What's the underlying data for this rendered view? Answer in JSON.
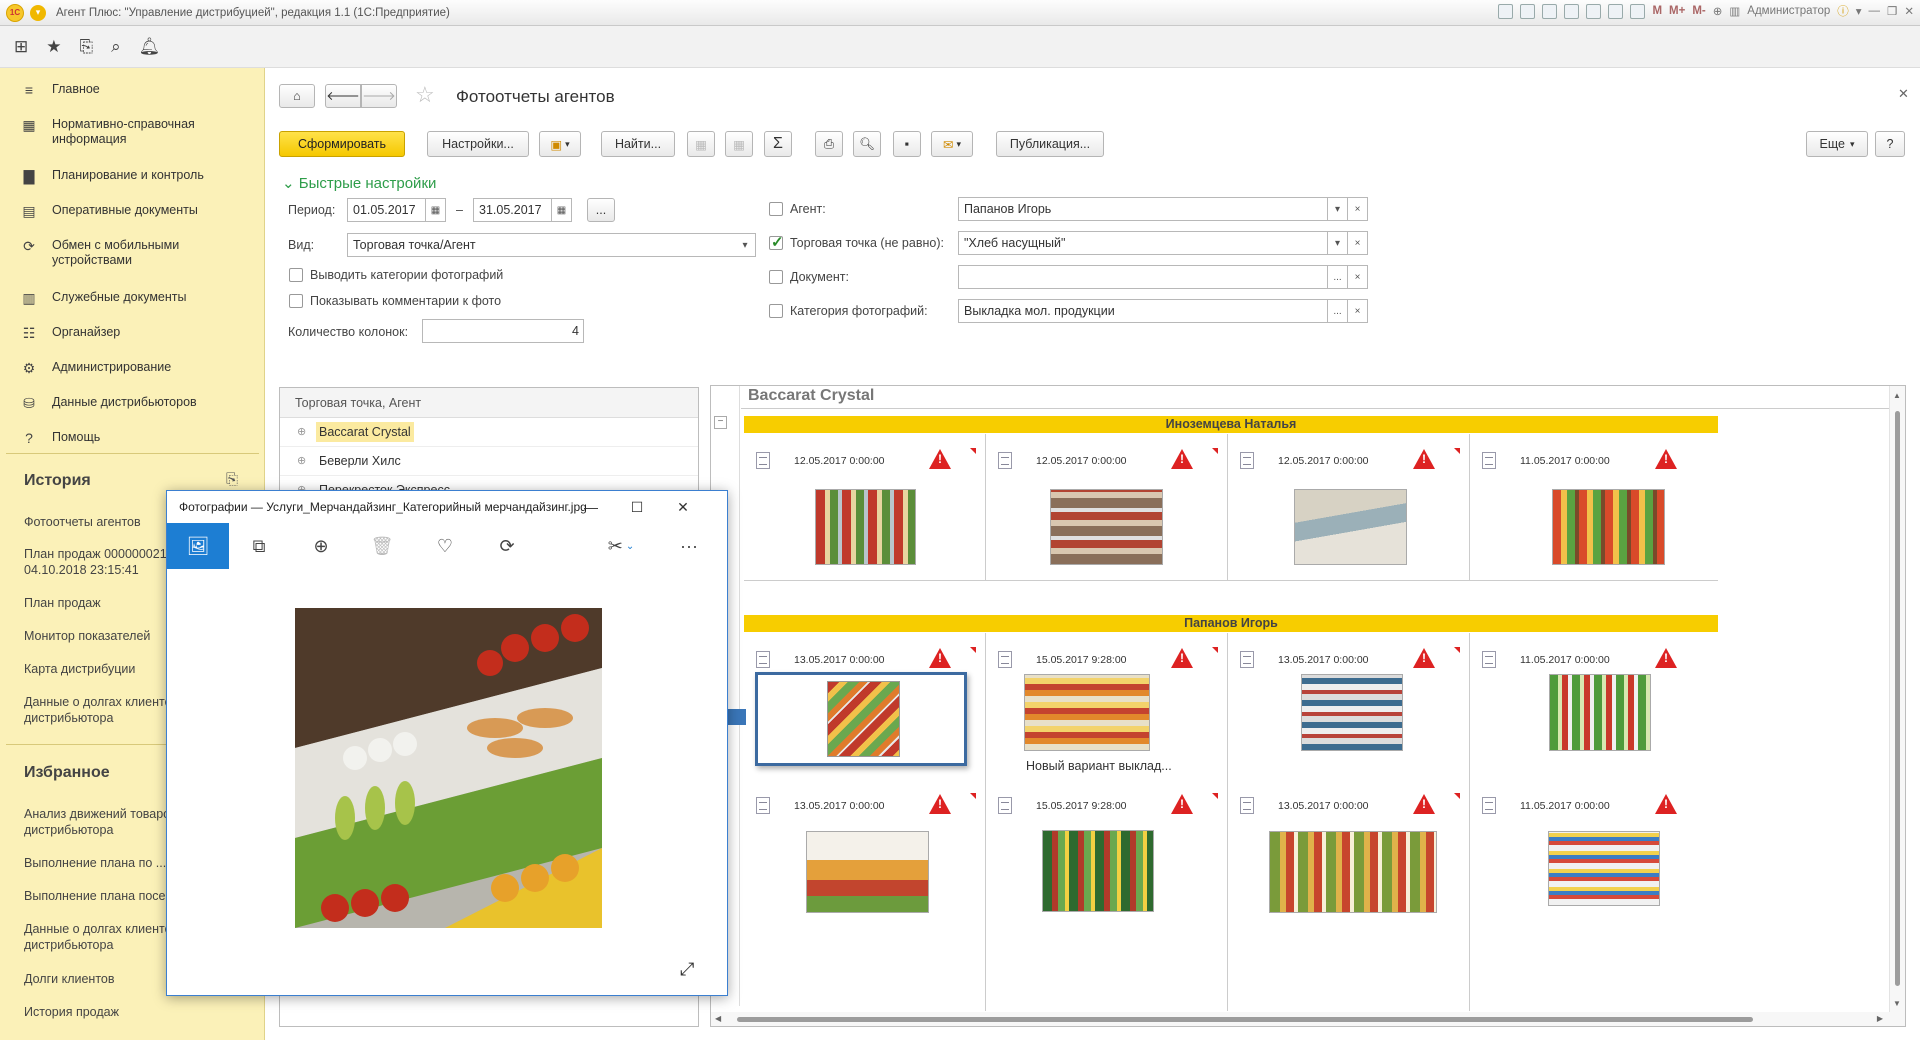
{
  "app": {
    "title": "Агент Плюс: \"Управление дистрибуцией\", редакция 1.1  (1С:Предприятие)",
    "user": "Администратор",
    "logo_text": "1С"
  },
  "titlebar_icons": [
    "print-icon",
    "save-icon",
    "search-icon",
    "compare-icon",
    "calendar-icon",
    "calculator-icon",
    "table-icon"
  ],
  "memory": [
    "M",
    "M+",
    "M-"
  ],
  "sidebar": {
    "items": [
      {
        "label": "Главное",
        "icon": "menu-icon"
      },
      {
        "label": "Нормативно-справочная информация",
        "icon": "catalog-icon"
      },
      {
        "label": "Планирование и контроль",
        "icon": "chart-icon"
      },
      {
        "label": "Оперативные документы",
        "icon": "documents-icon"
      },
      {
        "label": "Обмен с мобильными устройствами",
        "icon": "sync-icon"
      },
      {
        "label": "Служебные документы",
        "icon": "service-docs-icon"
      },
      {
        "label": "Органайзер",
        "icon": "organizer-icon"
      },
      {
        "label": "Администрирование",
        "icon": "gear-icon"
      },
      {
        "label": "Данные дистрибьюторов",
        "icon": "distributor-icon"
      },
      {
        "label": "Помощь",
        "icon": "help-icon"
      }
    ],
    "history_title": "История",
    "history": [
      "Фотоотчеты агентов",
      "План продаж 000000021 от 04.10.2018 23:15:41",
      "План продаж",
      "Монитор показателей",
      "Карта дистрибуции",
      "Данные о долгах клиентов дистрибьютора"
    ],
    "favorites_title": "Избранное",
    "favorites": [
      "Анализ движений товаров дистрибьютора",
      "Выполнение плана по ...",
      "Выполнение плана посещений",
      "Данные о долгах клиентов дистрибьютора",
      "Долги клиентов",
      "История продаж"
    ]
  },
  "form": {
    "title": "Фотоотчеты агентов",
    "buttons": {
      "generate": "Сформировать",
      "settings": "Настройки...",
      "find": "Найти...",
      "publish": "Публикация...",
      "more": "Еще",
      "help": "?",
      "sum": "Σ"
    },
    "quick_settings": "Быстрые настройки",
    "period_label": "Период:",
    "period_from": "01.05.2017",
    "period_to": "31.05.2017",
    "period_dash": "–",
    "view_label": "Вид:",
    "view_value": "Торговая точка/Агент",
    "opt_categories": "Выводить категории фотографий",
    "opt_comments": "Показывать комментарии к фото",
    "columns_label": "Количество колонок:",
    "columns_value": "4",
    "agent_label": "Агент:",
    "agent_value": "Папанов Игорь",
    "outlet_label": "Торговая точка (не равно):",
    "outlet_value": "\"Хлеб насущный\"",
    "document_label": "Документ:",
    "document_value": "",
    "category_label": "Категория фотографий:",
    "category_value": "Выкладка мол. продукции",
    "ellipsis": "...",
    "clear": "×",
    "drop": "▾"
  },
  "list": {
    "header": "Торговая точка, Агент",
    "rows": [
      "Baccarat Crystal",
      "Беверли Хилс",
      "Перекресток Экспресс"
    ]
  },
  "report": {
    "title": "Baccarat Crystal",
    "groups": [
      {
        "agent": "Иноземцева Наталья",
        "cells": [
          {
            "date": "12.05.2017 0:00:00",
            "caption": ""
          },
          {
            "date": "12.05.2017 0:00:00",
            "caption": ""
          },
          {
            "date": "12.05.2017 0:00:00",
            "caption": ""
          },
          {
            "date": "11.05.2017 0:00:00",
            "caption": ""
          }
        ]
      },
      {
        "agent": "Папанов Игорь",
        "cells": [
          {
            "date": "13.05.2017 0:00:00",
            "caption": ""
          },
          {
            "date": "15.05.2017 9:28:00",
            "caption": "Новый вариант выклад..."
          },
          {
            "date": "13.05.2017 0:00:00",
            "caption": ""
          },
          {
            "date": "11.05.2017 0:00:00",
            "caption": ""
          },
          {
            "date": "13.05.2017 0:00:00",
            "caption": ""
          },
          {
            "date": "15.05.2017 9:28:00",
            "caption": ""
          },
          {
            "date": "13.05.2017 0:00:00",
            "caption": ""
          },
          {
            "date": "11.05.2017 0:00:00",
            "caption": ""
          }
        ]
      }
    ]
  },
  "viewer": {
    "title": "Фотографии — Услуги_Мерчандайзинг_Категорийный мерчандайзинг.jpg",
    "more": "···"
  },
  "colors": {
    "sidebar": "#fbf1b8",
    "accent": "#f7cd00",
    "quick_settings": "#2e9d4a",
    "warning": "#dd2222",
    "viewer_accent": "#1d7ed3"
  }
}
